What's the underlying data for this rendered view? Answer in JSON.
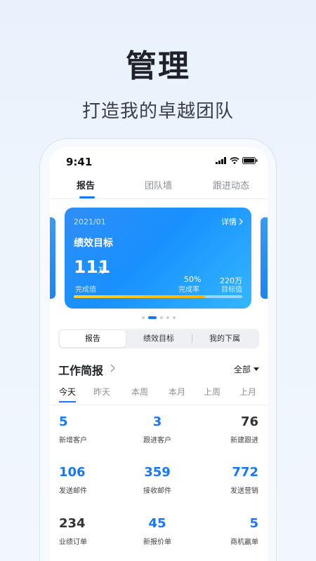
{
  "hero": {
    "title": "管理",
    "subtitle": "打造我的卓越团队"
  },
  "status_bar": {
    "time": "9:41"
  },
  "tabs": [
    {
      "label": "报告",
      "active": true
    },
    {
      "label": "团队墙",
      "active": false
    },
    {
      "label": "跟进动态",
      "active": false
    }
  ],
  "card": {
    "date": "2021/01",
    "detail_label": "详情",
    "title": "绩效目标",
    "completed_value": "111",
    "completed_unit": "万",
    "completed_label": "完成值",
    "rate_value": "50%",
    "rate_label": "完成率",
    "target_value": "220万",
    "target_label": "目标值",
    "progress": 0.78,
    "colors": {
      "start": "#2f8ef5",
      "end": "#33b7ff",
      "progress": "#ffc21a"
    }
  },
  "segment": [
    {
      "label": "报告",
      "active": true
    },
    {
      "label": "绩效目标",
      "active": false
    },
    {
      "label": "我的下属",
      "active": false
    }
  ],
  "brief": {
    "title": "工作简报",
    "filter": "全部"
  },
  "periods": [
    {
      "label": "今天",
      "active": true
    },
    {
      "label": "昨天",
      "active": false
    },
    {
      "label": "本周",
      "active": false
    },
    {
      "label": "本月",
      "active": false
    },
    {
      "label": "上周",
      "active": false
    },
    {
      "label": "上月",
      "active": false
    }
  ],
  "stats": [
    {
      "value": "5",
      "label": "新增客户",
      "highlight": true
    },
    {
      "value": "3",
      "label": "跟进客户",
      "highlight": true
    },
    {
      "value": "76",
      "label": "新建跟进",
      "highlight": false
    },
    {
      "value": "106",
      "label": "发送邮件",
      "highlight": true
    },
    {
      "value": "359",
      "label": "接收邮件",
      "highlight": true
    },
    {
      "value": "772",
      "label": "发送营销",
      "highlight": true
    },
    {
      "value": "234",
      "label": "业绩订单",
      "highlight": false
    },
    {
      "value": "45",
      "label": "新报价单",
      "highlight": true
    },
    {
      "value": "5",
      "label": "商机赢单",
      "highlight": true
    }
  ],
  "accent": "#1677ff"
}
